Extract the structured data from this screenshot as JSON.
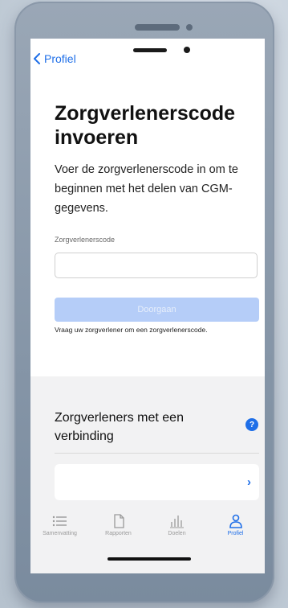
{
  "nav": {
    "back_label": "Profiel"
  },
  "page": {
    "title": "Zorgverlenerscode invoeren",
    "intro": "Voer de zorgverlenerscode in om te beginnen met het delen van CGM-gegevens."
  },
  "form": {
    "label": "Zorgverlenerscode",
    "value": "",
    "placeholder": "",
    "button_label": "Doorgaan",
    "hint": "Vraag uw zorgverlener om een zorgverlenerscode."
  },
  "connections": {
    "title": "Zorgverleners met een verbinding",
    "help_symbol": "?",
    "chevron_symbol": "›"
  },
  "tabs": [
    {
      "label": "Samenvatting",
      "icon": "list-icon",
      "active": false
    },
    {
      "label": "Rapporten",
      "icon": "document-icon",
      "active": false
    },
    {
      "label": "Doelen",
      "icon": "bar-chart-icon",
      "active": false
    },
    {
      "label": "Profiel",
      "icon": "person-icon",
      "active": true
    }
  ],
  "colors": {
    "accent": "#1f6fe8",
    "button_disabled": "#b5cdf8",
    "section_bg": "#f2f2f3"
  }
}
